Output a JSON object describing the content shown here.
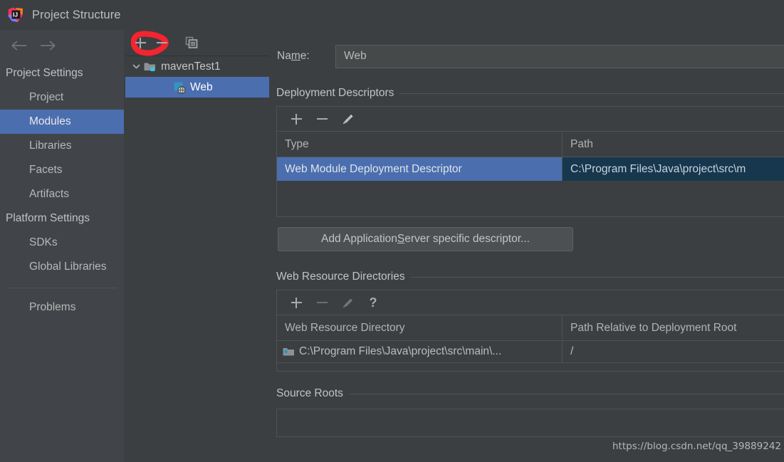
{
  "window": {
    "title": "Project Structure",
    "logo_icon": "intellij-idea-logo"
  },
  "nav": {
    "back_icon": "arrow-left-icon",
    "forward_icon": "arrow-right-icon"
  },
  "sidebar": {
    "groups": [
      {
        "label": "Project Settings",
        "items": [
          {
            "label": "Project",
            "selected": false
          },
          {
            "label": "Modules",
            "selected": true
          },
          {
            "label": "Libraries",
            "selected": false
          },
          {
            "label": "Facets",
            "selected": false
          },
          {
            "label": "Artifacts",
            "selected": false
          }
        ]
      },
      {
        "label": "Platform Settings",
        "items": [
          {
            "label": "SDKs",
            "selected": false
          },
          {
            "label": "Global Libraries",
            "selected": false
          }
        ]
      }
    ],
    "footer_items": [
      {
        "label": "Problems",
        "selected": false
      }
    ]
  },
  "tree": {
    "toolbar": {
      "add_icon": "plus-icon",
      "remove_icon": "minus-icon",
      "copy_icon": "copy-icon"
    },
    "annotation": {
      "shape": "hand-drawn-red-circle-highlight",
      "color": "#f42430",
      "targets": "plus-icon"
    },
    "nodes": [
      {
        "label": "mavenTest1",
        "icon": "module-folder-icon",
        "expanded": true,
        "twisty": "chevron-down-icon",
        "selected": false,
        "level": 0
      },
      {
        "label": "Web",
        "icon": "web-facet-icon",
        "selected": true,
        "level": 1
      }
    ]
  },
  "content": {
    "name": {
      "label_before": "Na",
      "label_mnemonic": "m",
      "label_after": "e:",
      "value": "Web",
      "placeholder": ""
    },
    "deployment_descriptors": {
      "title": "Deployment Descriptors",
      "toolbar": {
        "add_icon": "plus-icon",
        "remove_icon": "minus-icon",
        "edit_icon": "pencil-icon"
      },
      "columns": [
        "Type",
        "Path"
      ],
      "rows": [
        {
          "type": "Web Module Deployment Descriptor",
          "path": "C:\\Program Files\\Java\\project\\src\\m",
          "selected": true
        }
      ],
      "add_server_button": {
        "before": "Add Application ",
        "mnemonic": "S",
        "after": "erver specific descriptor..."
      }
    },
    "web_resource_directories": {
      "title": "Web Resource Directories",
      "toolbar": {
        "add_icon": "plus-icon",
        "remove_icon": "minus-icon",
        "edit_icon": "pencil-icon",
        "help_icon": "question-icon"
      },
      "columns": [
        "Web Resource Directory",
        "Path Relative to Deployment Root"
      ],
      "rows": [
        {
          "icon": "folder-icon",
          "directory": "C:\\Program Files\\Java\\project\\src\\main\\...",
          "relative_path": "/"
        }
      ]
    },
    "source_roots": {
      "title": "Source Roots"
    }
  },
  "watermark": {
    "text": "https://blog.csdn.net/qq_39889242"
  },
  "colors": {
    "background": "#3c3f41",
    "sidebar": "#414549",
    "selection": "#4b6eaf",
    "selection_secondary": "#17374e",
    "annotation_red": "#f42430",
    "text": "#bbbbbb",
    "border": "#4e5254"
  }
}
